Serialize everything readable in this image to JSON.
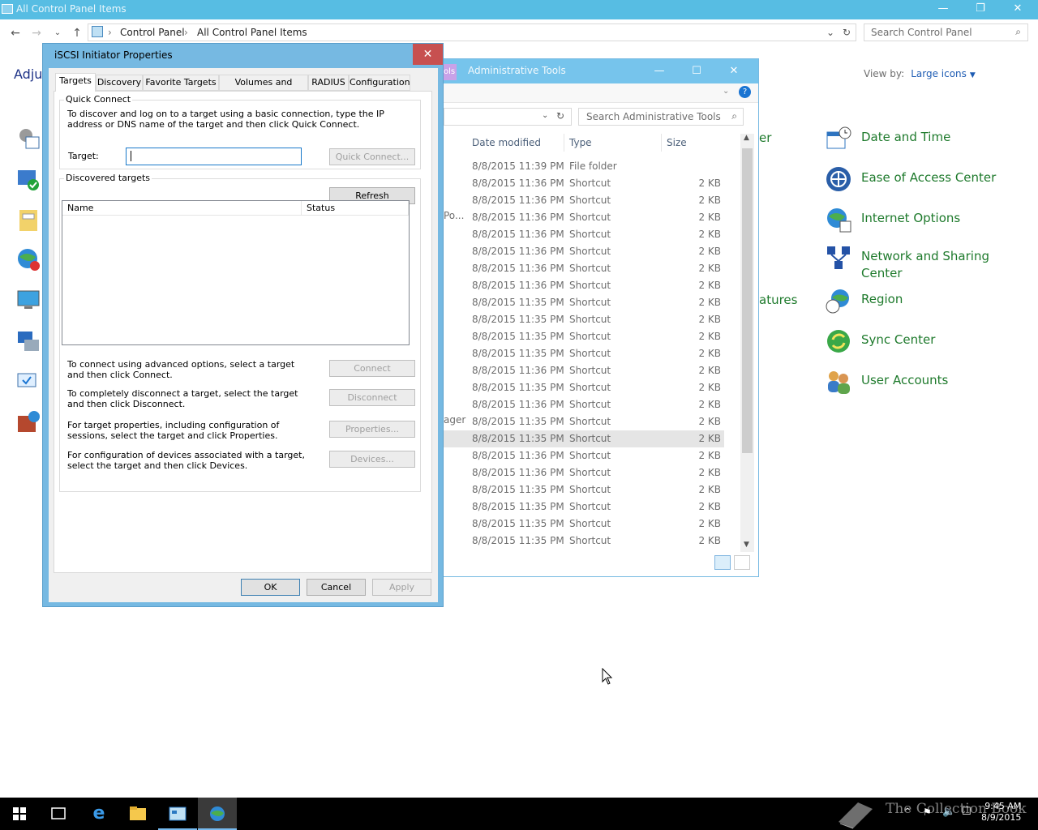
{
  "control_panel": {
    "title": "All Control Panel Items",
    "breadcrumb": [
      "Control Panel",
      "All Control Panel Items"
    ],
    "search_placeholder": "Search Control Panel",
    "adjust_text": "Adjus",
    "view_by_label": "View by:",
    "view_by_value": "Large icons",
    "partial_labels": [
      "er",
      "atures"
    ],
    "items": [
      {
        "label": "Date and Time",
        "icon": "calendar-clock-icon"
      },
      {
        "label": "Ease of Access Center",
        "icon": "ease-of-access-icon"
      },
      {
        "label": "Internet Options",
        "icon": "globe-icon"
      },
      {
        "label": "Network and Sharing Center",
        "icon": "network-icon"
      },
      {
        "label": "Region",
        "icon": "region-globe-clock-icon"
      },
      {
        "label": "Sync Center",
        "icon": "sync-icon"
      },
      {
        "label": "User Accounts",
        "icon": "users-icon"
      }
    ]
  },
  "admin_tools": {
    "title": "Administrative Tools",
    "tag": "ols",
    "search_placeholder": "Search Administrative Tools",
    "columns": [
      "Date modified",
      "Type",
      "Size"
    ],
    "partial_names": [
      "Po...",
      "ager"
    ],
    "rows": [
      {
        "date": "8/8/2015 11:39 PM",
        "type": "File folder",
        "size": ""
      },
      {
        "date": "8/8/2015 11:36 PM",
        "type": "Shortcut",
        "size": "2 KB"
      },
      {
        "date": "8/8/2015 11:36 PM",
        "type": "Shortcut",
        "size": "2 KB"
      },
      {
        "date": "8/8/2015 11:36 PM",
        "type": "Shortcut",
        "size": "2 KB"
      },
      {
        "date": "8/8/2015 11:36 PM",
        "type": "Shortcut",
        "size": "2 KB"
      },
      {
        "date": "8/8/2015 11:36 PM",
        "type": "Shortcut",
        "size": "2 KB"
      },
      {
        "date": "8/8/2015 11:36 PM",
        "type": "Shortcut",
        "size": "2 KB"
      },
      {
        "date": "8/8/2015 11:36 PM",
        "type": "Shortcut",
        "size": "2 KB"
      },
      {
        "date": "8/8/2015 11:35 PM",
        "type": "Shortcut",
        "size": "2 KB"
      },
      {
        "date": "8/8/2015 11:35 PM",
        "type": "Shortcut",
        "size": "2 KB"
      },
      {
        "date": "8/8/2015 11:35 PM",
        "type": "Shortcut",
        "size": "2 KB"
      },
      {
        "date": "8/8/2015 11:35 PM",
        "type": "Shortcut",
        "size": "2 KB"
      },
      {
        "date": "8/8/2015 11:36 PM",
        "type": "Shortcut",
        "size": "2 KB"
      },
      {
        "date": "8/8/2015 11:35 PM",
        "type": "Shortcut",
        "size": "2 KB"
      },
      {
        "date": "8/8/2015 11:36 PM",
        "type": "Shortcut",
        "size": "2 KB"
      },
      {
        "date": "8/8/2015 11:35 PM",
        "type": "Shortcut",
        "size": "2 KB"
      },
      {
        "date": "8/8/2015 11:35 PM",
        "type": "Shortcut",
        "size": "2 KB"
      },
      {
        "date": "8/8/2015 11:36 PM",
        "type": "Shortcut",
        "size": "2 KB"
      },
      {
        "date": "8/8/2015 11:36 PM",
        "type": "Shortcut",
        "size": "2 KB"
      },
      {
        "date": "8/8/2015 11:35 PM",
        "type": "Shortcut",
        "size": "2 KB"
      },
      {
        "date": "8/8/2015 11:35 PM",
        "type": "Shortcut",
        "size": "2 KB"
      },
      {
        "date": "8/8/2015 11:35 PM",
        "type": "Shortcut",
        "size": "2 KB"
      },
      {
        "date": "8/8/2015 11:35 PM",
        "type": "Shortcut",
        "size": "2 KB"
      }
    ]
  },
  "dialog": {
    "title": "iSCSI Initiator Properties",
    "close": "✕",
    "tabs": [
      "Targets",
      "Discovery",
      "Favorite Targets",
      "Volumes and Devices",
      "RADIUS",
      "Configuration"
    ],
    "quick_connect": {
      "group_label": "Quick Connect",
      "description": "To discover and log on to a target using a basic connection, type the IP address or DNS name of the target and then click Quick Connect.",
      "target_label": "Target:",
      "target_value": "",
      "button": "Quick Connect..."
    },
    "discovered": {
      "group_label": "Discovered targets",
      "refresh": "Refresh",
      "columns": [
        "Name",
        "Status"
      ]
    },
    "actions": [
      {
        "text": "To connect using advanced options, select a target and then click Connect.",
        "button": "Connect"
      },
      {
        "text": "To completely disconnect a target, select the target and then click Disconnect.",
        "button": "Disconnect"
      },
      {
        "text": "For target properties, including configuration of sessions, select the target and click Properties.",
        "button": "Properties..."
      },
      {
        "text": "For configuration of devices associated with a target, select the target and then click Devices.",
        "button": "Devices..."
      }
    ],
    "footer": {
      "ok": "OK",
      "cancel": "Cancel",
      "apply": "Apply"
    }
  },
  "taskbar": {
    "time": "9:45 AM",
    "date": "8/9/2015",
    "watermark": "The Collection Book"
  }
}
